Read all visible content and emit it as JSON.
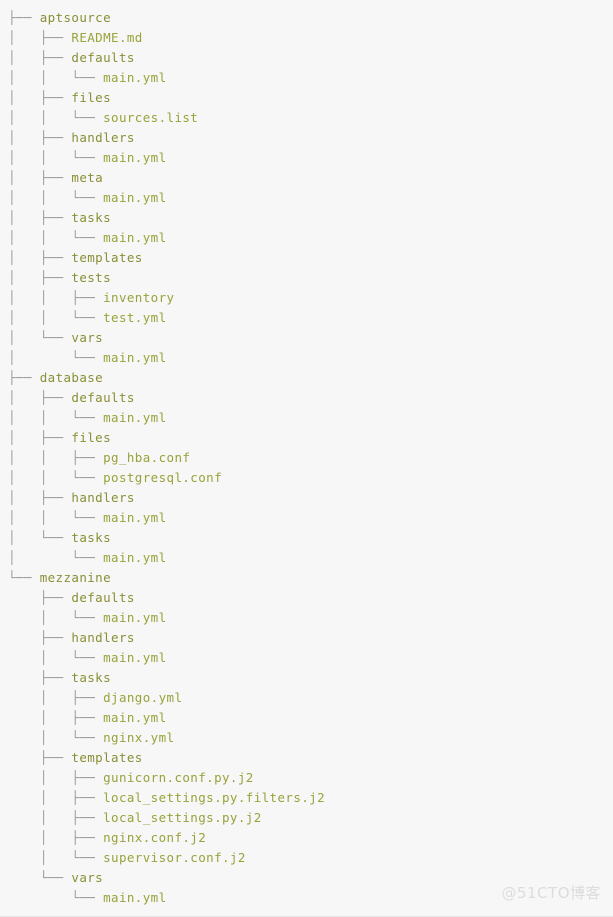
{
  "view": {
    "kind": "terminal-tree-output",
    "background_color": "#f7f7f7",
    "dir_color": "#8a8f35",
    "file_color": "#9aa23a",
    "branch_color": "#9a9a9a"
  },
  "watermark": {
    "text": "@51CTO博客"
  },
  "glyphs": {
    "tee": "├── ",
    "elbow": "└── ",
    "pipe": "│   ",
    "blank": "    "
  },
  "tree": {
    "lines": [
      {
        "prefix": "├── ",
        "name": "aptsource",
        "type": "dir"
      },
      {
        "prefix": "│   ├── ",
        "name": "README.md",
        "type": "file"
      },
      {
        "prefix": "│   ├── ",
        "name": "defaults",
        "type": "dir"
      },
      {
        "prefix": "│   │   └── ",
        "name": "main.yml",
        "type": "file"
      },
      {
        "prefix": "│   ├── ",
        "name": "files",
        "type": "dir"
      },
      {
        "prefix": "│   │   └── ",
        "name": "sources.list",
        "type": "file"
      },
      {
        "prefix": "│   ├── ",
        "name": "handlers",
        "type": "dir"
      },
      {
        "prefix": "│   │   └── ",
        "name": "main.yml",
        "type": "file"
      },
      {
        "prefix": "│   ├── ",
        "name": "meta",
        "type": "dir"
      },
      {
        "prefix": "│   │   └── ",
        "name": "main.yml",
        "type": "file"
      },
      {
        "prefix": "│   ├── ",
        "name": "tasks",
        "type": "dir"
      },
      {
        "prefix": "│   │   └── ",
        "name": "main.yml",
        "type": "file"
      },
      {
        "prefix": "│   ├── ",
        "name": "templates",
        "type": "dir"
      },
      {
        "prefix": "│   ├── ",
        "name": "tests",
        "type": "dir"
      },
      {
        "prefix": "│   │   ├── ",
        "name": "inventory",
        "type": "file"
      },
      {
        "prefix": "│   │   └── ",
        "name": "test.yml",
        "type": "file"
      },
      {
        "prefix": "│   └── ",
        "name": "vars",
        "type": "dir"
      },
      {
        "prefix": "│       └── ",
        "name": "main.yml",
        "type": "file"
      },
      {
        "prefix": "├── ",
        "name": "database",
        "type": "dir"
      },
      {
        "prefix": "│   ├── ",
        "name": "defaults",
        "type": "dir"
      },
      {
        "prefix": "│   │   └── ",
        "name": "main.yml",
        "type": "file"
      },
      {
        "prefix": "│   ├── ",
        "name": "files",
        "type": "dir"
      },
      {
        "prefix": "│   │   ├── ",
        "name": "pg_hba.conf",
        "type": "file"
      },
      {
        "prefix": "│   │   └── ",
        "name": "postgresql.conf",
        "type": "file"
      },
      {
        "prefix": "│   ├── ",
        "name": "handlers",
        "type": "dir"
      },
      {
        "prefix": "│   │   └── ",
        "name": "main.yml",
        "type": "file"
      },
      {
        "prefix": "│   └── ",
        "name": "tasks",
        "type": "dir"
      },
      {
        "prefix": "│       └── ",
        "name": "main.yml",
        "type": "file"
      },
      {
        "prefix": "└── ",
        "name": "mezzanine",
        "type": "dir"
      },
      {
        "prefix": "    ├── ",
        "name": "defaults",
        "type": "dir"
      },
      {
        "prefix": "    │   └── ",
        "name": "main.yml",
        "type": "file"
      },
      {
        "prefix": "    ├── ",
        "name": "handlers",
        "type": "dir"
      },
      {
        "prefix": "    │   └── ",
        "name": "main.yml",
        "type": "file"
      },
      {
        "prefix": "    ├── ",
        "name": "tasks",
        "type": "dir"
      },
      {
        "prefix": "    │   ├── ",
        "name": "django.yml",
        "type": "file"
      },
      {
        "prefix": "    │   ├── ",
        "name": "main.yml",
        "type": "file"
      },
      {
        "prefix": "    │   └── ",
        "name": "nginx.yml",
        "type": "file"
      },
      {
        "prefix": "    ├── ",
        "name": "templates",
        "type": "dir"
      },
      {
        "prefix": "    │   ├── ",
        "name": "gunicorn.conf.py.j2",
        "type": "file"
      },
      {
        "prefix": "    │   ├── ",
        "name": "local_settings.py.filters.j2",
        "type": "file"
      },
      {
        "prefix": "    │   ├── ",
        "name": "local_settings.py.j2",
        "type": "file"
      },
      {
        "prefix": "    │   ├── ",
        "name": "nginx.conf.j2",
        "type": "file"
      },
      {
        "prefix": "    │   └── ",
        "name": "supervisor.conf.j2",
        "type": "file"
      },
      {
        "prefix": "    └── ",
        "name": "vars",
        "type": "dir"
      },
      {
        "prefix": "        └── ",
        "name": "main.yml",
        "type": "file"
      }
    ]
  }
}
